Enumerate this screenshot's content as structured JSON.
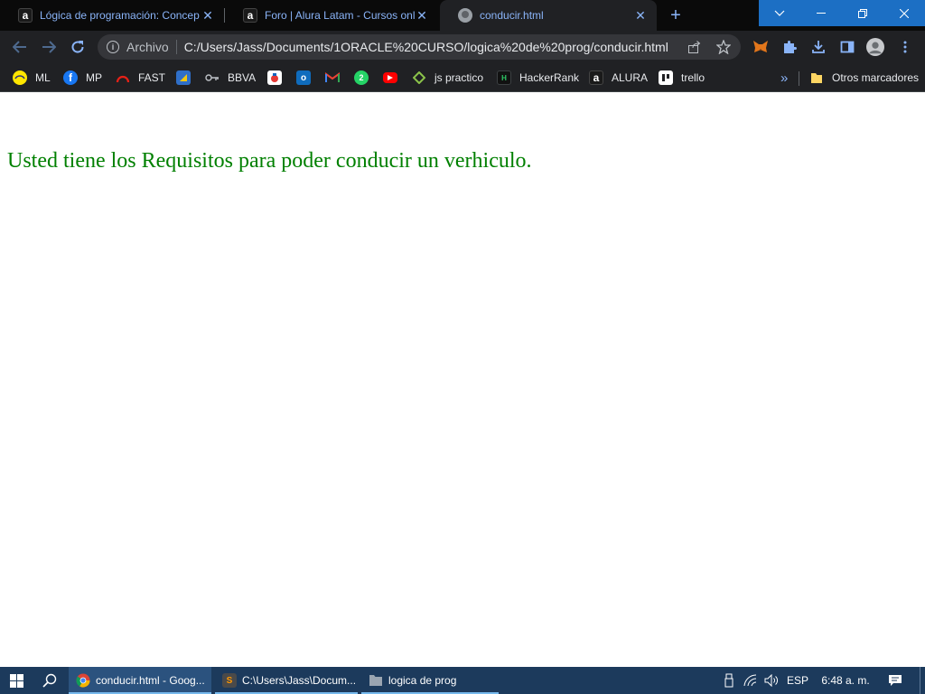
{
  "browser": {
    "tabs": [
      {
        "title": "Lógica de programación: Concep",
        "favicon": "alura-icon"
      },
      {
        "title": "Foro | Alura Latam - Cursos onlin",
        "favicon": "alura-icon"
      },
      {
        "title": "conducir.html",
        "favicon": "globe-icon"
      }
    ],
    "close_glyph": "✕",
    "new_tab_glyph": "+",
    "address": {
      "scheme_label": "Archivo",
      "url": "C:/Users/Jass/Documents/1ORACLE%20CURSO/logica%20de%20prog/conducir.html"
    },
    "bookmarks": [
      {
        "label": "ML",
        "icon": "mercadolibre-icon",
        "color": "#ffe600"
      },
      {
        "label": "MP",
        "icon": "facebook-icon",
        "color": "#1877f2"
      },
      {
        "label": "FAST",
        "icon": "speedometer-icon",
        "color": "#e62117"
      },
      {
        "label": "",
        "icon": "power-bi-icon",
        "color": "#2f6fc9"
      },
      {
        "label": "BBVA",
        "icon": "key-icon",
        "color": "#9aa0a6"
      },
      {
        "label": "",
        "icon": "app-red-icon",
        "color": "#e53935"
      },
      {
        "label": "",
        "icon": "outlook-icon",
        "color": "#0f6cbd"
      },
      {
        "label": "",
        "icon": "gmail-icon",
        "color": "#ea4335"
      },
      {
        "label": "",
        "icon": "whatsapp-icon",
        "color": "#25d366"
      },
      {
        "label": "",
        "icon": "youtube-icon",
        "color": "#ff0000"
      },
      {
        "label": "js practico",
        "icon": "diamond-icon",
        "color": "#8bc34a"
      },
      {
        "label": "HackerRank",
        "icon": "hackerrank-icon",
        "color": "#111111"
      },
      {
        "label": "ALURA",
        "icon": "alura-icon",
        "color": "#1a1a1a"
      },
      {
        "label": "trello",
        "icon": "trello-icon",
        "color": "#ffffff"
      }
    ],
    "more_bookmarks_glyph": "»",
    "other_bookmarks": "Otros marcadores"
  },
  "page": {
    "message": "Usted tiene los Requisitos para poder conducir un verhiculo."
  },
  "taskbar": {
    "apps": [
      {
        "label": "conducir.html - Goog...",
        "icon": "chrome-icon"
      },
      {
        "label": "C:\\Users\\Jass\\Docum...",
        "icon": "sublime-text-icon"
      },
      {
        "label": "logica de prog",
        "icon": "folder-icon"
      }
    ],
    "language": "ESP",
    "time": "6:48 a. m."
  },
  "colors": {
    "message_text": "#008000",
    "chrome_dark": "#202124",
    "accent_blue": "#8ab4f8",
    "taskbar": "#1c3a5c"
  }
}
